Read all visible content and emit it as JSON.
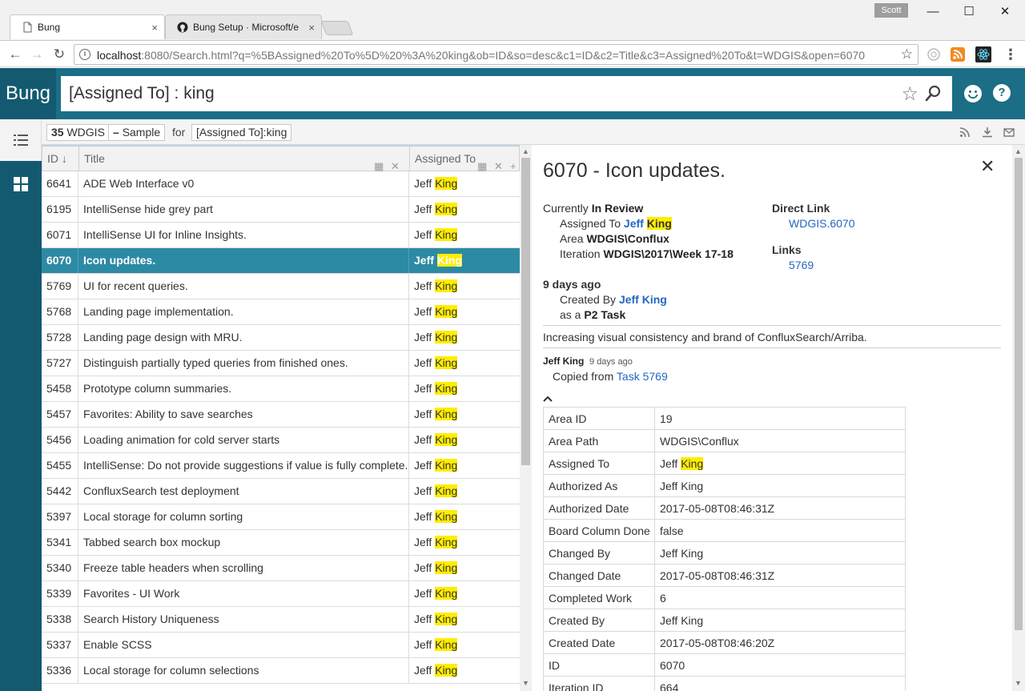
{
  "browser": {
    "tabs": [
      {
        "title": "Bung",
        "close": "×"
      },
      {
        "title": "Bung Setup · Microsoft/e",
        "close": "×"
      }
    ],
    "profile": "Scott",
    "window_controls": {
      "minimize": "—",
      "maximize": "☐",
      "close": "✕"
    },
    "url": {
      "host": "localhost",
      "rest": ":8080/Search.html?q=%5BAssigned%20To%5D%20%3A%20king&ob=ID&so=desc&c1=ID&c2=Title&c3=Assigned%20To&t=WDGIS&open=6070"
    }
  },
  "app": {
    "brand": "Bung",
    "query": "[Assigned To] : king",
    "help_label": "?"
  },
  "result_bar": {
    "count": "35",
    "source": "WDGIS",
    "sample_label": "Sample",
    "for_label": "for",
    "query_chip": "[Assigned To]:king"
  },
  "grid": {
    "columns": {
      "id": "ID ↓",
      "title": "Title",
      "assigned": "Assigned To"
    },
    "selected_id": "6070",
    "rows": [
      {
        "id": "6641",
        "title": "ADE Web Interface v0",
        "first": "Jeff ",
        "match": "King"
      },
      {
        "id": "6195",
        "title": "IntelliSense hide grey part",
        "first": "Jeff ",
        "match": "King"
      },
      {
        "id": "6071",
        "title": "IntelliSense UI for Inline Insights.",
        "first": "Jeff ",
        "match": "King"
      },
      {
        "id": "6070",
        "title": "Icon updates.",
        "first": "Jeff ",
        "match": "King"
      },
      {
        "id": "5769",
        "title": "UI for recent queries.",
        "first": "Jeff ",
        "match": "King"
      },
      {
        "id": "5768",
        "title": "Landing page implementation.",
        "first": "Jeff ",
        "match": "King"
      },
      {
        "id": "5728",
        "title": "Landing page design with MRU.",
        "first": "Jeff ",
        "match": "King"
      },
      {
        "id": "5727",
        "title": "Distinguish partially typed queries from finished ones.",
        "first": "Jeff ",
        "match": "King"
      },
      {
        "id": "5458",
        "title": "Prototype column summaries.",
        "first": "Jeff ",
        "match": "King"
      },
      {
        "id": "5457",
        "title": "Favorites: Ability to save searches",
        "first": "Jeff ",
        "match": "King"
      },
      {
        "id": "5456",
        "title": "Loading animation for cold server starts",
        "first": "Jeff ",
        "match": "King"
      },
      {
        "id": "5455",
        "title": "IntelliSense: Do not provide suggestions if value is fully complete.",
        "first": "Jeff ",
        "match": "King"
      },
      {
        "id": "5442",
        "title": "ConfluxSearch test deployment",
        "first": "Jeff ",
        "match": "King"
      },
      {
        "id": "5397",
        "title": "Local storage for column sorting",
        "first": "Jeff ",
        "match": "King"
      },
      {
        "id": "5341",
        "title": "Tabbed search box mockup",
        "first": "Jeff ",
        "match": "King"
      },
      {
        "id": "5340",
        "title": "Freeze table headers when scrolling",
        "first": "Jeff ",
        "match": "King"
      },
      {
        "id": "5339",
        "title": "Favorites - UI Work",
        "first": "Jeff ",
        "match": "King"
      },
      {
        "id": "5338",
        "title": "Search History Uniqueness",
        "first": "Jeff ",
        "match": "King"
      },
      {
        "id": "5337",
        "title": "Enable SCSS",
        "first": "Jeff ",
        "match": "King"
      },
      {
        "id": "5336",
        "title": "Local storage for column selections",
        "first": "Jeff ",
        "match": "King"
      }
    ]
  },
  "detail": {
    "title": "6070 - Icon updates.",
    "close": "✕",
    "currently_label": "Currently",
    "state": "In Review",
    "assigned_label": "Assigned To",
    "assigned_first": "Jeff",
    "assigned_match": "King",
    "area_label": "Area",
    "area": "WDGIS\\Conflux",
    "iteration_label": "Iteration",
    "iteration": "WDGIS\\2017\\Week 17-18",
    "direct_link_label": "Direct Link",
    "direct_link": "WDGIS.6070",
    "links_label": "Links",
    "link": "5769",
    "age": "9 days ago",
    "created_by_label": "Created By",
    "created_by": "Jeff King",
    "as_a_label": "as a",
    "type": "P2 Task",
    "description": "Increasing visual consistency and brand of ConfluxSearch/Arriba.",
    "comment_author": "Jeff King",
    "comment_time": "9 days ago",
    "comment_text": "Copied from",
    "comment_link": "Task 5769",
    "fields": [
      {
        "key": "Area ID",
        "value": "19"
      },
      {
        "key": "Area Path",
        "value": "WDGIS\\Conflux"
      },
      {
        "key": "Assigned To",
        "value": "Jeff ",
        "match": "King"
      },
      {
        "key": "Authorized As",
        "value": "Jeff King"
      },
      {
        "key": "Authorized Date",
        "value": "2017-05-08T08:46:31Z"
      },
      {
        "key": "Board Column Done",
        "value": "false"
      },
      {
        "key": "Changed By",
        "value": "Jeff King"
      },
      {
        "key": "Changed Date",
        "value": "2017-05-08T08:46:31Z"
      },
      {
        "key": "Completed Work",
        "value": "6"
      },
      {
        "key": "Created By",
        "value": "Jeff King"
      },
      {
        "key": "Created Date",
        "value": "2017-05-08T08:46:20Z"
      },
      {
        "key": "ID",
        "value": "6070"
      },
      {
        "key": "Iteration ID",
        "value": "664"
      }
    ]
  },
  "colors": {
    "header": "#1b6e86",
    "nav": "#135a70",
    "selected_row": "#2d8aa4",
    "highlight": "#ffed00",
    "link": "#2367c0"
  }
}
